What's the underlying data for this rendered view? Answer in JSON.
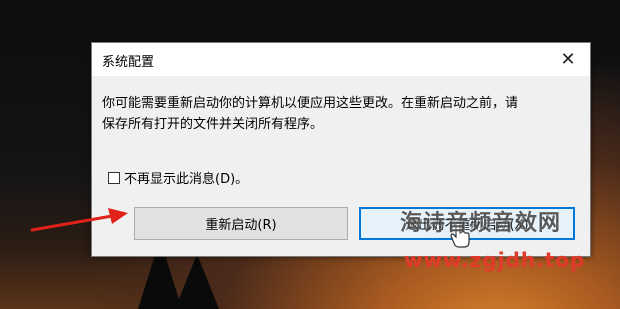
{
  "dialog": {
    "title": "系统配置",
    "close_glyph": "✕",
    "message_line1": "你可能需要重新启动你的计算机以便应用这些更改。在重新启动之前，请",
    "message_line2": "保存所有打开的文件并关闭所有程序。",
    "checkbox_label": "不再显示此消息(D)。",
    "restart_button_label": "重新启动(R)",
    "later_button_label": "退出而不重新启动(X)"
  },
  "watermark": {
    "line1": "海诗音频音效网",
    "line2": "www.zgjdh.top"
  },
  "colors": {
    "arrow": "#e0221a",
    "focus_border": "#0078d7",
    "watermark_red": "#e03a2a"
  },
  "icons": {
    "close": "close-icon",
    "pointer": "annotation-arrow-icon",
    "cursor": "hand-cursor-icon"
  }
}
